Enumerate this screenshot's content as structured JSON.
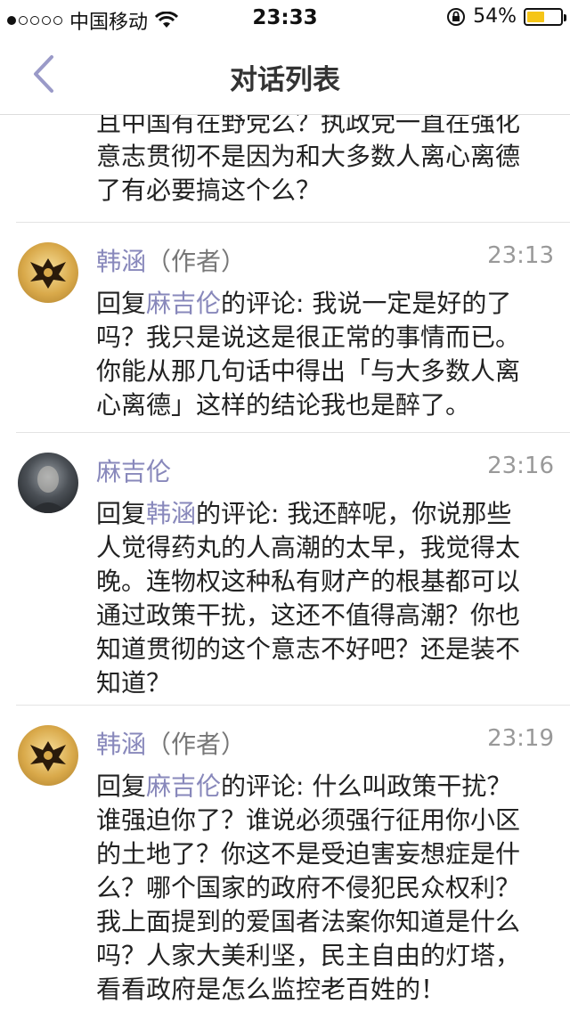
{
  "status_bar": {
    "carrier": "中国移动",
    "time": "23:33",
    "battery": "54%",
    "battery_level": 0.54
  },
  "nav": {
    "title": "对话列表",
    "back_icon": "chevron-left-icon"
  },
  "partial_text_lines": [
    "且中国有在野党么？执政党一直在强化",
    "意志贯彻不是因为和大多数人离心离德",
    "了有必要搞这个么？"
  ],
  "comments": [
    {
      "name": "韩涵",
      "author_tag": "（作者）",
      "time": "23:13",
      "reply_prefix": "回复",
      "reply_to": "麻吉伦",
      "reply_suffix": "的评论: ",
      "first_line": "我说一定是好的了",
      "lines": [
        "吗？我只是说这是很正常的事情而已。",
        "你能从那几句话中得出「与大多数人离",
        "心离德」这样的结论我也是醉了。"
      ]
    },
    {
      "name": "麻吉伦",
      "author_tag": "",
      "time": "23:16",
      "reply_prefix": "回复",
      "reply_to": "韩涵",
      "reply_suffix": "的评论: ",
      "first_line": "我还醉呢，你说那些",
      "lines": [
        "人觉得药丸的人高潮的太早，我觉得太",
        "晚。连物权这种私有财产的根基都可以",
        "通过政策干扰，这还不值得高潮？你也",
        "知道贯彻的这个意志不好吧？还是装不",
        "知道？"
      ]
    },
    {
      "name": "韩涵",
      "author_tag": "（作者）",
      "time": "23:19",
      "reply_prefix": "回复",
      "reply_to": "麻吉伦",
      "reply_suffix": "的评论: ",
      "first_line": "什么叫政策干扰？",
      "lines": [
        "谁强迫你了？谁说必须强行征用你小区",
        "的土地了？你这不是受迫害妄想症是什",
        "么？哪个国家的政府不侵犯民众权利？",
        "我上面提到的爱国者法案你知道是什么",
        "吗？人家大美利坚，民主自由的灯塔，",
        "看看政府是怎么监控老百姓的！"
      ]
    }
  ]
}
